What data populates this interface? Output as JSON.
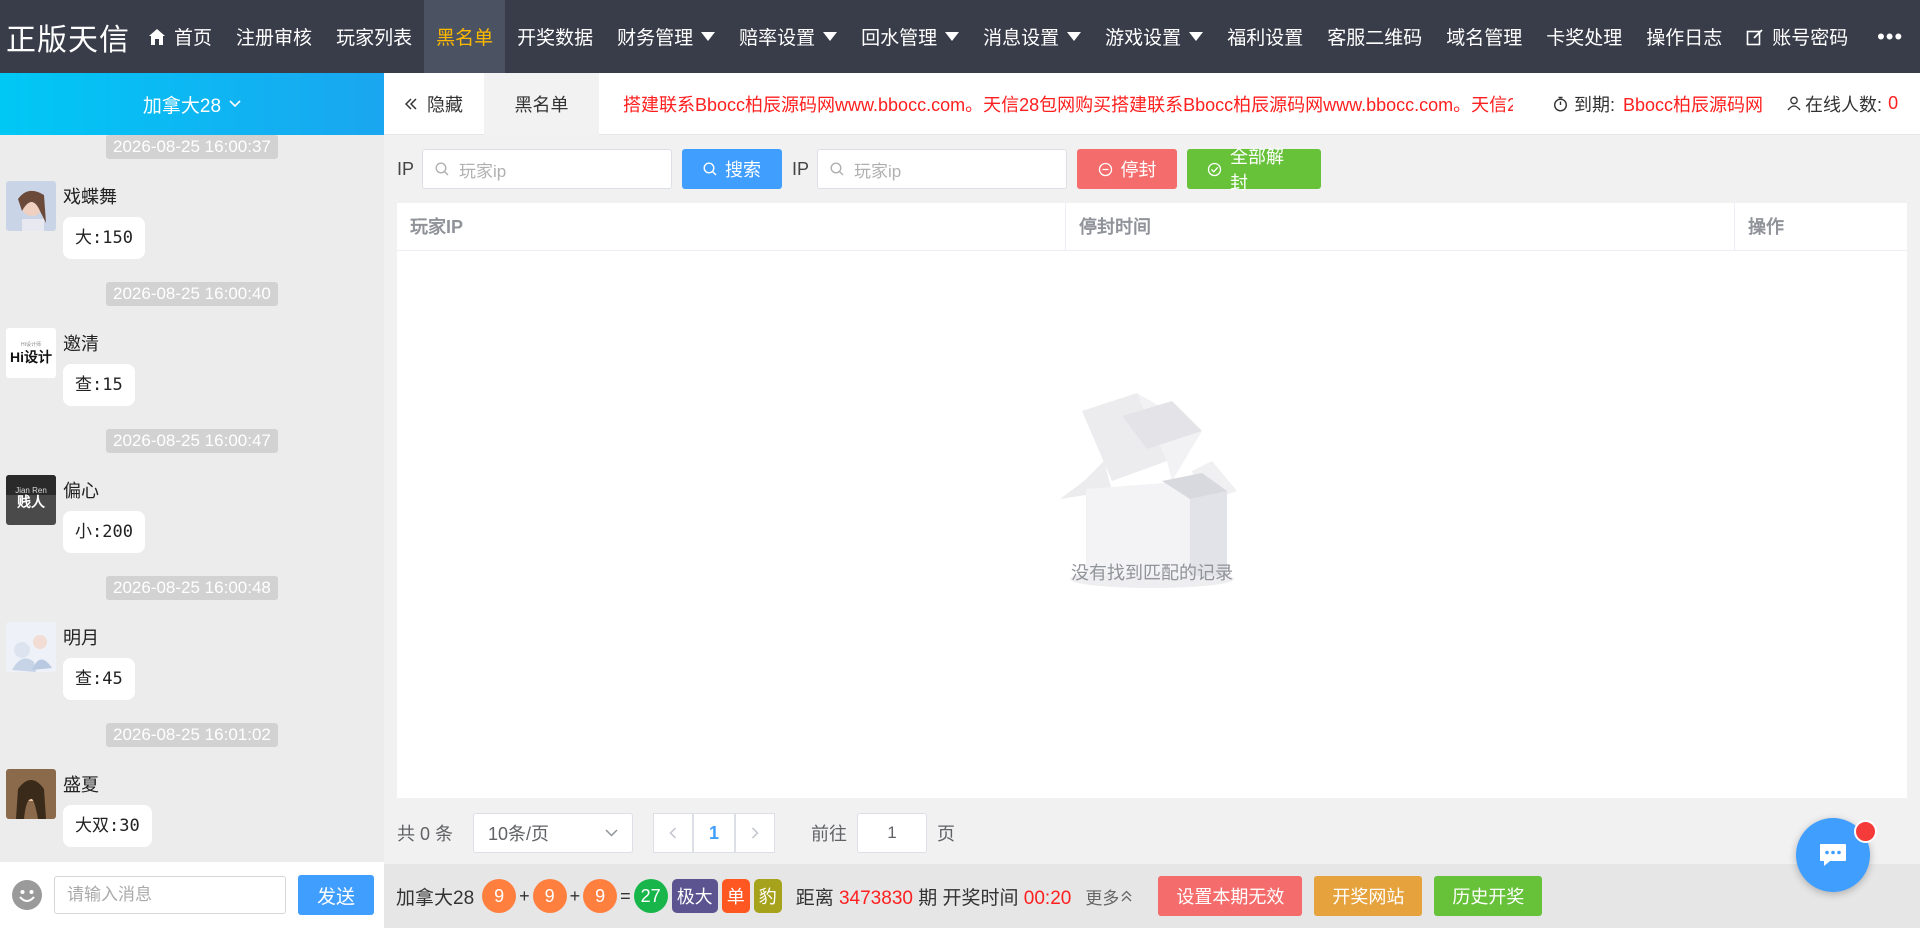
{
  "brand": "正版天信",
  "nav": {
    "items": [
      {
        "label": "首页",
        "icon": "home-icon"
      },
      {
        "label": "注册审核"
      },
      {
        "label": "玩家列表"
      },
      {
        "label": "黑名单",
        "active": true
      },
      {
        "label": "开奖数据"
      },
      {
        "label": "财务管理",
        "dropdown": true
      },
      {
        "label": "赔率设置",
        "dropdown": true
      },
      {
        "label": "回水管理",
        "dropdown": true
      },
      {
        "label": "消息设置",
        "dropdown": true
      },
      {
        "label": "游戏设置",
        "dropdown": true
      },
      {
        "label": "福利设置"
      },
      {
        "label": "客服二维码"
      },
      {
        "label": "域名管理"
      },
      {
        "label": "卡奖处理"
      },
      {
        "label": "操作日志"
      },
      {
        "label": "账号密码",
        "icon": "edit-icon"
      }
    ],
    "more": "•••"
  },
  "left": {
    "room": "加拿大28",
    "messages": [
      {
        "time": "2026-08-25 16:00:37",
        "user": "戏蝶舞",
        "text": "大:150"
      },
      {
        "time": "2026-08-25 16:00:40",
        "user": "邀清",
        "text": "查:15"
      },
      {
        "time": "2026-08-25 16:00:47",
        "user": "偏心",
        "text": "小:200"
      },
      {
        "time": "2026-08-25 16:00:48",
        "user": "明月",
        "text": "查:45"
      },
      {
        "time": "2026-08-25 16:01:02",
        "user": "盛夏",
        "text": "大双:30"
      }
    ],
    "avatar_text": {
      "hi": "Hi设计",
      "hi_small": "HI设计师",
      "jr_top": "Jian Ren",
      "jr_main": "贱人"
    },
    "input_placeholder": "请输入消息",
    "send": "发送"
  },
  "tabbar": {
    "hide": "隐藏",
    "tab": "黑名单",
    "marquee": "搭建联系Bbocc柏辰源码网www.bbocc.com。天信28包网购买搭建联系Bbocc柏辰源码网www.bbocc.com。天信2",
    "expire_label": "到期:",
    "expire_value": "Bbocc柏辰源码网",
    "online_label": "在线人数:",
    "online_value": "0"
  },
  "toolbar": {
    "ip_label": "IP",
    "ip_placeholder": "玩家ip",
    "search": "搜索",
    "ip_label2": "IP",
    "ip_placeholder2": "玩家ip",
    "ban": "停封",
    "unban_all": "全部解封"
  },
  "table": {
    "columns": [
      "玩家IP",
      "停封时间",
      "操作"
    ],
    "rows": [],
    "empty_text": "没有找到匹配的记录"
  },
  "pager": {
    "total": "共 0 条",
    "page_size": "10条/页",
    "current": "1",
    "goto_label": "前往",
    "goto_value": "1",
    "goto_suffix": "页"
  },
  "bottom": {
    "lottery": "加拿大28",
    "balls": [
      "9",
      "9",
      "9"
    ],
    "sum": "27",
    "tags": [
      "极大",
      "单",
      "豹"
    ],
    "issue_prefix": "距离",
    "issue_no": "3473830",
    "issue_mid": "期 开奖时间",
    "countdown": "00:20",
    "more": "更多",
    "btn_invalid": "设置本期无效",
    "btn_site": "开奖网站",
    "btn_history": "历史开奖"
  },
  "colors": {
    "nav_bg": "#393d49",
    "accent": "#409eff",
    "active_nav": "#ffb800",
    "danger": "#f56c6c",
    "success": "#67c23a"
  }
}
